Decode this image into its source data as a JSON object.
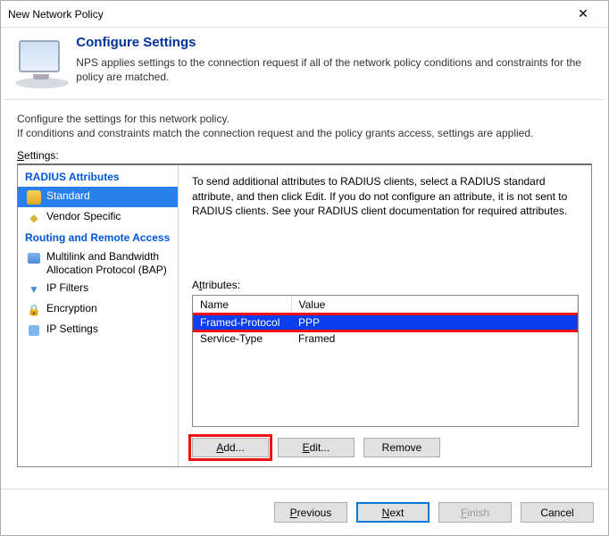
{
  "window": {
    "title": "New Network Policy"
  },
  "header": {
    "title": "Configure Settings",
    "desc": "NPS applies settings to the connection request if all of the network policy conditions and constraints for the policy are matched."
  },
  "intro": {
    "line1": "Configure the settings for this network policy.",
    "line2": "If conditions and constraints match the connection request and the policy grants access, settings are applied."
  },
  "settings_label": "Settings:",
  "sidebar": {
    "cat_radius": "RADIUS Attributes",
    "standard": "Standard",
    "vendor": "Vendor Specific",
    "cat_rras": "Routing and Remote Access",
    "multilink": "Multilink and Bandwidth Allocation Protocol (BAP)",
    "filters": "IP Filters",
    "encryption": "Encryption",
    "ipsettings": "IP Settings"
  },
  "content": {
    "desc": "To send additional attributes to RADIUS clients, select a RADIUS standard attribute, and then click Edit. If you do not configure an attribute, it is not sent to RADIUS clients. See your RADIUS client documentation for required attributes.",
    "attr_label": "Attributes:",
    "columns": {
      "name": "Name",
      "value": "Value"
    },
    "rows": [
      {
        "name": "Framed-Protocol",
        "value": "PPP",
        "selected": true
      },
      {
        "name": "Service-Type",
        "value": "Framed",
        "selected": false
      }
    ],
    "buttons": {
      "add": "Add...",
      "edit": "Edit...",
      "remove": "Remove"
    }
  },
  "footer": {
    "previous": "Previous",
    "next": "Next",
    "finish": "Finish",
    "cancel": "Cancel"
  }
}
